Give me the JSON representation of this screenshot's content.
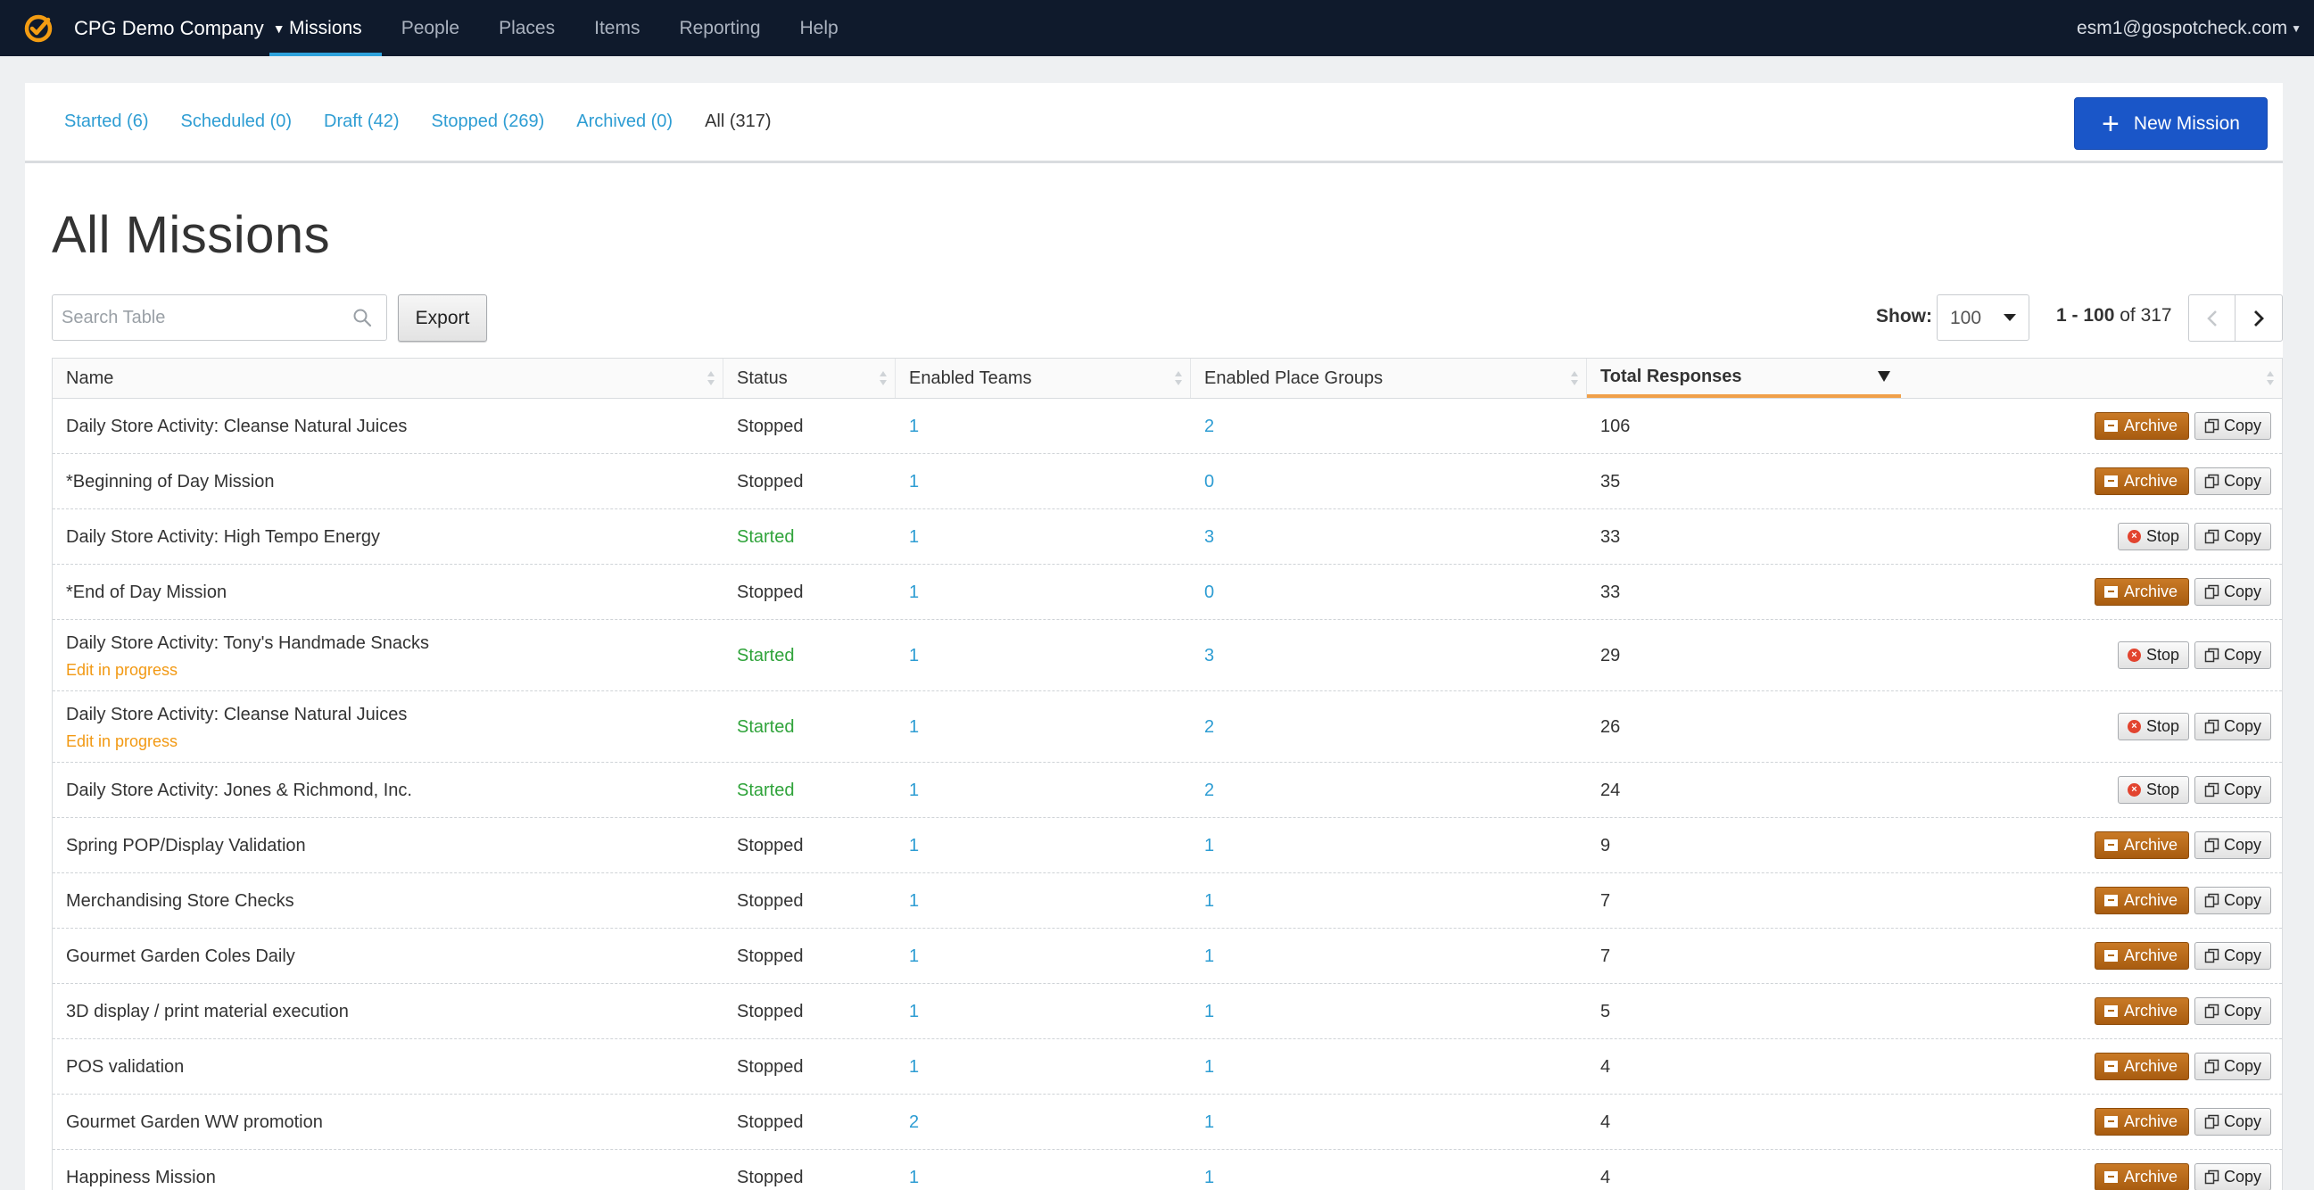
{
  "topnav": {
    "company": "CPG Demo Company",
    "items": [
      "Missions",
      "People",
      "Places",
      "Items",
      "Reporting",
      "Help"
    ],
    "active_item": "Missions",
    "user": "esm1@gospotcheck.com"
  },
  "tabs": [
    {
      "label": "Started (6)"
    },
    {
      "label": "Scheduled (0)"
    },
    {
      "label": "Draft (42)"
    },
    {
      "label": "Stopped (269)"
    },
    {
      "label": "Archived (0)"
    },
    {
      "label": "All (317)"
    }
  ],
  "new_mission_label": "New Mission",
  "page_title": "All Missions",
  "search": {
    "placeholder": "Search Table",
    "value": ""
  },
  "export_label": "Export",
  "show": {
    "label": "Show:",
    "value": "100"
  },
  "range": {
    "bold": "1 - 100",
    "rest": " of 317"
  },
  "columns": [
    "Name",
    "Status",
    "Enabled Teams",
    "Enabled Place Groups",
    "Total Responses"
  ],
  "sorted_column": "Total Responses",
  "action_labels": {
    "archive": "Archive",
    "stop": "Stop",
    "copy": "Copy"
  },
  "rows": [
    {
      "name": "Daily Store Activity: Cleanse Natural Juices",
      "note": "",
      "status": "Stopped",
      "teams": "1",
      "groups": "2",
      "responses": "106",
      "action": "Archive"
    },
    {
      "name": "*Beginning of Day Mission",
      "note": "",
      "status": "Stopped",
      "teams": "1",
      "groups": "0",
      "responses": "35",
      "action": "Archive"
    },
    {
      "name": "Daily Store Activity: High Tempo Energy",
      "note": "",
      "status": "Started",
      "teams": "1",
      "groups": "3",
      "responses": "33",
      "action": "Stop"
    },
    {
      "name": "*End of Day Mission",
      "note": "",
      "status": "Stopped",
      "teams": "1",
      "groups": "0",
      "responses": "33",
      "action": "Archive"
    },
    {
      "name": "Daily Store Activity: Tony's Handmade Snacks",
      "note": "Edit in progress",
      "status": "Started",
      "teams": "1",
      "groups": "3",
      "responses": "29",
      "action": "Stop"
    },
    {
      "name": "Daily Store Activity: Cleanse Natural Juices",
      "note": "Edit in progress",
      "status": "Started",
      "teams": "1",
      "groups": "2",
      "responses": "26",
      "action": "Stop"
    },
    {
      "name": "Daily Store Activity: Jones & Richmond, Inc.",
      "note": "",
      "status": "Started",
      "teams": "1",
      "groups": "2",
      "responses": "24",
      "action": "Stop"
    },
    {
      "name": "Spring POP/Display Validation",
      "note": "",
      "status": "Stopped",
      "teams": "1",
      "groups": "1",
      "responses": "9",
      "action": "Archive"
    },
    {
      "name": "Merchandising Store Checks",
      "note": "",
      "status": "Stopped",
      "teams": "1",
      "groups": "1",
      "responses": "7",
      "action": "Archive"
    },
    {
      "name": "Gourmet Garden Coles Daily",
      "note": "",
      "status": "Stopped",
      "teams": "1",
      "groups": "1",
      "responses": "7",
      "action": "Archive"
    },
    {
      "name": "3D display / print material execution",
      "note": "",
      "status": "Stopped",
      "teams": "1",
      "groups": "1",
      "responses": "5",
      "action": "Archive"
    },
    {
      "name": "POS validation",
      "note": "",
      "status": "Stopped",
      "teams": "1",
      "groups": "1",
      "responses": "4",
      "action": "Archive"
    },
    {
      "name": "Gourmet Garden WW promotion",
      "note": "",
      "status": "Stopped",
      "teams": "2",
      "groups": "1",
      "responses": "4",
      "action": "Archive"
    },
    {
      "name": "Happiness Mission",
      "note": "",
      "status": "Stopped",
      "teams": "1",
      "groups": "1",
      "responses": "4",
      "action": "Archive"
    }
  ],
  "colors": {
    "nav_bg": "#0f1a2c",
    "link": "#2e9dd3",
    "started": "#2fa33a",
    "edit_note": "#f29913",
    "archive": "#b86b18",
    "primary": "#1a56c8",
    "logo": "#f39c12"
  }
}
